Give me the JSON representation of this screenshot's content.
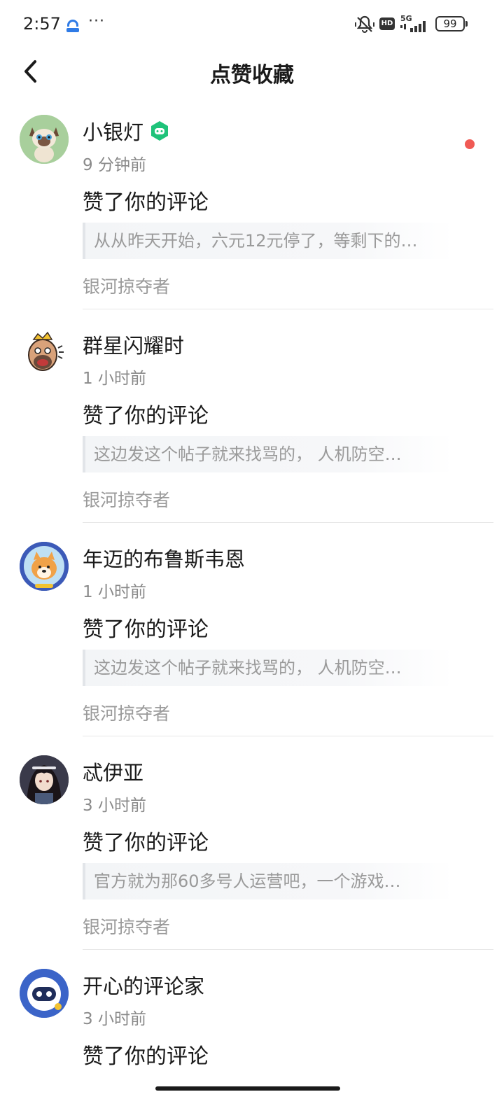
{
  "status_bar": {
    "time": "2:57",
    "dots": "···",
    "battery": "99",
    "hd_label": "HD",
    "network_label": "5G"
  },
  "header": {
    "title": "点赞收藏"
  },
  "notifications": [
    {
      "user": "小银灯",
      "has_badge": true,
      "time": "9 分钟前",
      "action": "赞了你的评论",
      "quote": "从从昨天开始，六元12元停了，等剩下的…",
      "source": "银河掠夺者",
      "unread": true
    },
    {
      "user": "群星闪耀时",
      "has_badge": false,
      "time": "1 小时前",
      "action": "赞了你的评论",
      "quote": "这边发这个帖子就来找骂的， 人机防空…",
      "source": "银河掠夺者",
      "unread": false
    },
    {
      "user": "年迈的布鲁斯韦恩",
      "has_badge": false,
      "time": "1 小时前",
      "action": "赞了你的评论",
      "quote": "这边发这个帖子就来找骂的， 人机防空…",
      "source": "银河掠夺者",
      "unread": false
    },
    {
      "user": "忒伊亚",
      "has_badge": false,
      "time": "3 小时前",
      "action": "赞了你的评论",
      "quote": "官方就为那60多号人运营吧，一个游戏…",
      "source": "银河掠夺者",
      "unread": false
    },
    {
      "user": "开心的评论家",
      "has_badge": false,
      "time": "3 小时前",
      "action": "赞了你的评论",
      "quote": "",
      "source": "",
      "unread": false
    }
  ],
  "colors": {
    "accent_badge": "#1fc37a",
    "unread_dot": "#f05a54",
    "muted_text": "#9a9a9a"
  }
}
